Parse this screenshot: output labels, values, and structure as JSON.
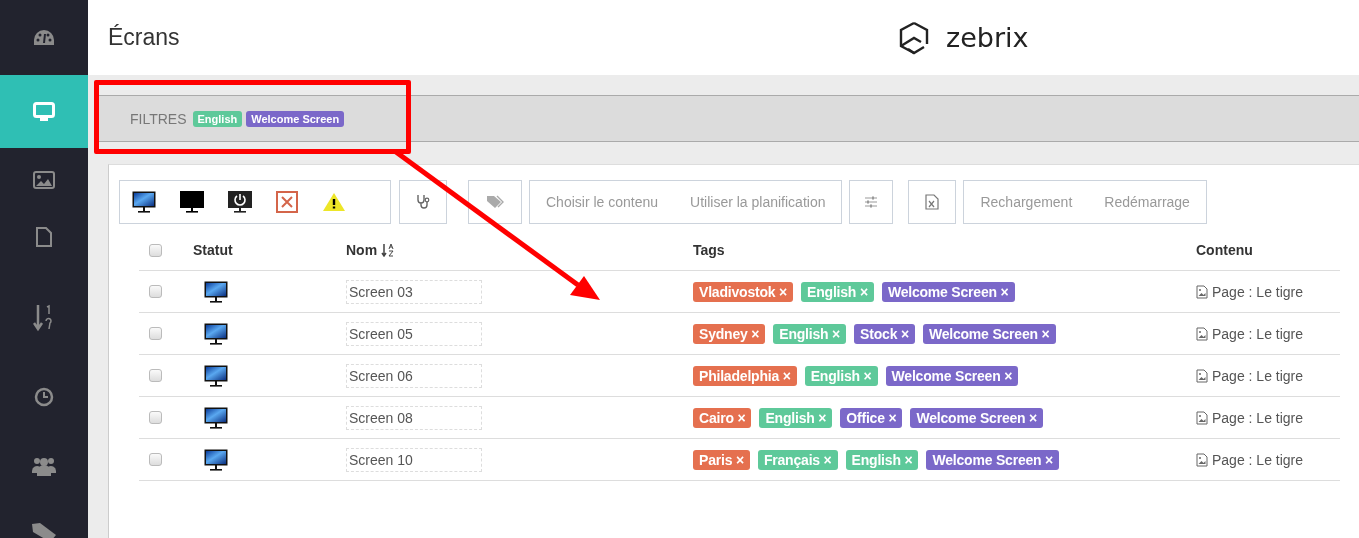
{
  "sidebar": {
    "items": [
      {
        "selected": false
      },
      {
        "selected": true
      },
      {
        "selected": false
      },
      {
        "selected": false
      },
      {
        "selected": false
      },
      {
        "selected": false
      },
      {
        "selected": false
      },
      {
        "selected": false
      }
    ]
  },
  "header": {
    "title": "Écrans",
    "logo_text": "zebrix"
  },
  "filters": {
    "label": "FILTRES",
    "chips": [
      {
        "label": "English",
        "color": "#5ec99a"
      },
      {
        "label": "Welcome Screen",
        "color": "#7b68c9"
      }
    ]
  },
  "toolbar": {
    "content_buttons": [
      {
        "label": "Choisir le contenu",
        "disabled": true
      },
      {
        "label": "Utiliser la planification",
        "disabled": true
      }
    ],
    "device_buttons": [
      {
        "label": "Rechargement",
        "disabled": true
      },
      {
        "label": "Redémarrage",
        "disabled": true
      }
    ]
  },
  "table": {
    "select_all": {
      "checked": false
    },
    "columns": [
      {
        "label": "Statut"
      },
      {
        "label": "Nom",
        "sorted": true
      },
      {
        "label": "Tags"
      },
      {
        "label": "Contenu"
      }
    ],
    "rows": [
      {
        "checked": false,
        "name": "Screen 03",
        "tags": [
          {
            "label": "Vladivostok ×",
            "color": "#e5704f"
          },
          {
            "label": "English ×",
            "color": "#5ec99a"
          },
          {
            "label": "Welcome Screen ×",
            "color": "#7b68c9"
          }
        ],
        "content": "Page : Le tigre"
      },
      {
        "checked": false,
        "name": "Screen 05",
        "tags": [
          {
            "label": "Sydney ×",
            "color": "#e5704f"
          },
          {
            "label": "English ×",
            "color": "#5ec99a"
          },
          {
            "label": "Stock ×",
            "color": "#7b68c9"
          },
          {
            "label": "Welcome Screen ×",
            "color": "#7b68c9"
          }
        ],
        "content": "Page : Le tigre"
      },
      {
        "checked": false,
        "name": "Screen 06",
        "tags": [
          {
            "label": "Philadelphia ×",
            "color": "#e5704f"
          },
          {
            "label": "English ×",
            "color": "#5ec99a"
          },
          {
            "label": "Welcome Screen ×",
            "color": "#7b68c9"
          }
        ],
        "content": "Page : Le tigre"
      },
      {
        "checked": false,
        "name": "Screen 08",
        "tags": [
          {
            "label": "Cairo ×",
            "color": "#e5704f"
          },
          {
            "label": "English ×",
            "color": "#5ec99a"
          },
          {
            "label": "Office ×",
            "color": "#7b68c9"
          },
          {
            "label": "Welcome Screen ×",
            "color": "#7b68c9"
          }
        ],
        "content": "Page : Le tigre"
      },
      {
        "checked": false,
        "name": "Screen 10",
        "tags": [
          {
            "label": "Paris ×",
            "color": "#e5704f"
          },
          {
            "label": "Français ×",
            "color": "#5ec99a"
          },
          {
            "label": "English ×",
            "color": "#5ec99a"
          },
          {
            "label": "Welcome Screen ×",
            "color": "#7b68c9"
          }
        ],
        "content": "Page : Le tigre"
      }
    ]
  }
}
